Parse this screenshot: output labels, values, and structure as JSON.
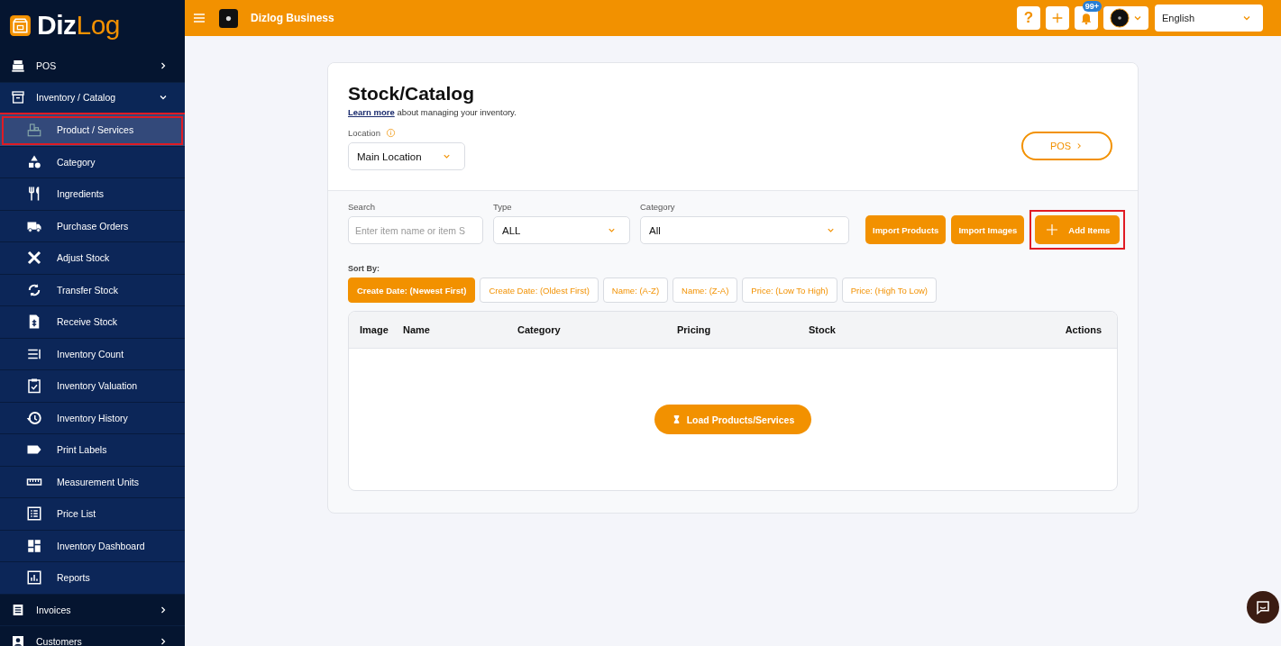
{
  "sidebar": {
    "logo_text": "Diz",
    "logo_accent": "Log",
    "items": [
      {
        "label": "POS",
        "expanded": false,
        "highlighted": false
      },
      {
        "label": "Inventory / Catalog",
        "expanded": true,
        "highlighted": true,
        "children": [
          {
            "label": "Product / Services",
            "selected": true,
            "highlighted": true
          },
          {
            "label": "Category",
            "selected": false,
            "highlighted": false
          },
          {
            "label": "Ingredients",
            "selected": false,
            "highlighted": false
          },
          {
            "label": "Purchase Orders",
            "selected": false,
            "highlighted": false
          },
          {
            "label": "Adjust Stock",
            "selected": false,
            "highlighted": false
          },
          {
            "label": "Transfer Stock",
            "selected": false,
            "highlighted": false
          },
          {
            "label": "Receive Stock",
            "selected": false,
            "highlighted": false
          },
          {
            "label": "Inventory Count",
            "selected": false,
            "highlighted": false
          },
          {
            "label": "Inventory Valuation",
            "selected": false,
            "highlighted": false
          },
          {
            "label": "Inventory History",
            "selected": false,
            "highlighted": false
          },
          {
            "label": "Print Labels",
            "selected": false,
            "highlighted": false
          },
          {
            "label": "Measurement Units",
            "selected": false,
            "highlighted": false
          },
          {
            "label": "Price List",
            "selected": false,
            "highlighted": false
          },
          {
            "label": "Inventory Dashboard",
            "selected": false,
            "highlighted": false
          },
          {
            "label": "Reports",
            "selected": false,
            "highlighted": false
          }
        ]
      },
      {
        "label": "Invoices",
        "expanded": false,
        "highlighted": false
      },
      {
        "label": "Customers",
        "expanded": false
      }
    ]
  },
  "topbar": {
    "business_name": "Dizlog Business",
    "help": "?",
    "notification_badge": "99+",
    "language": "English"
  },
  "page": {
    "title": "Stock/Catalog",
    "learn_more": "Learn more",
    "description": " about managing your inventory.",
    "location": {
      "label": "Location",
      "value": "Main Location"
    },
    "pos_button": "POS",
    "filters": {
      "search": {
        "label": "Search",
        "placeholder": "Enter item name or item S"
      },
      "type": {
        "label": "Type",
        "value": "ALL"
      },
      "category": {
        "label": "Category",
        "value": "All"
      }
    },
    "actions": [
      {
        "label": "Import Products",
        "kind": "plain",
        "highlighted": false
      },
      {
        "label": "Import Images",
        "kind": "plain",
        "highlighted": false
      },
      {
        "label": "Add Items",
        "kind": "add",
        "highlighted": true
      }
    ],
    "sort": {
      "label": "Sort By:",
      "options": [
        {
          "label": "Create Date: (Newest First)",
          "selected": true
        },
        {
          "label": "Create Date: (Oldest First)",
          "selected": false
        },
        {
          "label": "Name: (A-Z)",
          "selected": false
        },
        {
          "label": "Name: (Z-A)",
          "selected": false
        },
        {
          "label": "Price: (Low To High)",
          "selected": false
        },
        {
          "label": "Price: (High To Low)",
          "selected": false
        }
      ]
    },
    "table": {
      "columns": [
        "Image",
        "Name",
        "Category",
        "Pricing",
        "Stock",
        "Actions"
      ],
      "load_button": "Load Products/Services"
    }
  }
}
